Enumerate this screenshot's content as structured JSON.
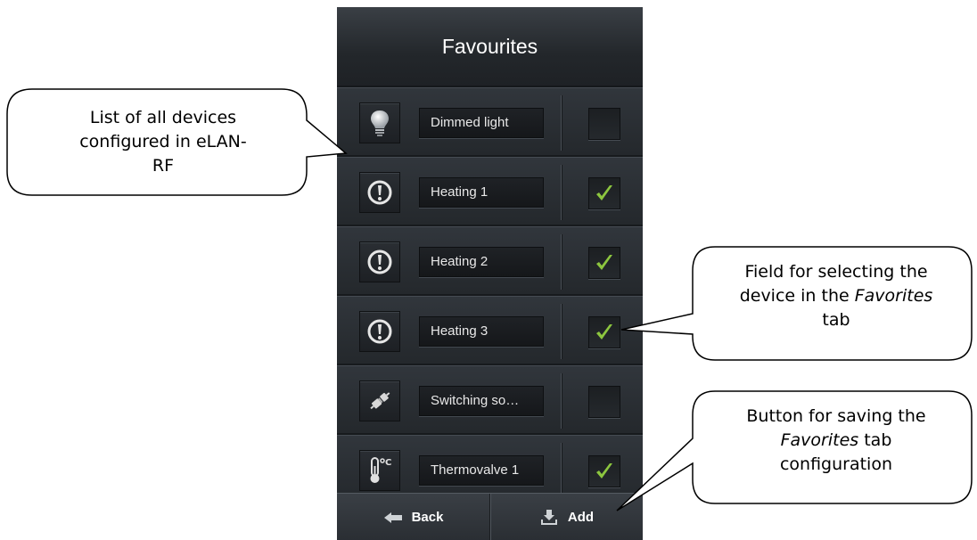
{
  "header": {
    "title": "Favourites"
  },
  "devices": [
    {
      "icon": "bulb-icon",
      "label": "Dimmed light",
      "checked": false
    },
    {
      "icon": "heating-icon",
      "label": "Heating 1",
      "checked": true
    },
    {
      "icon": "heating-icon",
      "label": "Heating 2",
      "checked": true
    },
    {
      "icon": "heating-icon",
      "label": "Heating 3",
      "checked": true
    },
    {
      "icon": "plug-icon",
      "label": "Switching so…",
      "checked": false
    },
    {
      "icon": "thermometer-icon",
      "label": "Thermovalve 1",
      "checked": true
    }
  ],
  "footer": {
    "back_label": "Back",
    "add_label": "Add"
  },
  "callouts": {
    "list": "List of all devices configured in eLAN-RF",
    "field_line1": "Field for selecting the",
    "field_line2a": "device in the ",
    "field_line2b": "Favorites",
    "field_line3": "tab",
    "button_line1": "Button for saving the",
    "button_line2a": "Favorites",
    "button_line2b": " tab",
    "button_line3": "configuration"
  },
  "colors": {
    "check": "#8cc63f",
    "background": "#2a2e33"
  }
}
